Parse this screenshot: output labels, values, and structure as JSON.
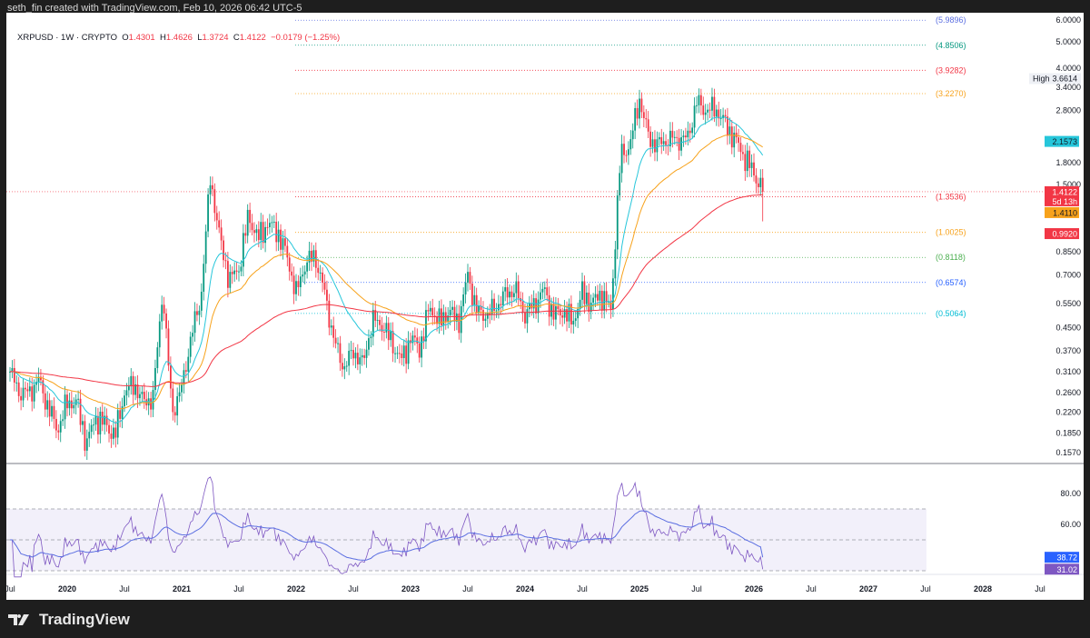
{
  "attribution": "seth_fin created with TradingView.com, Feb 10, 2026 06:42 UTC-5",
  "legend": {
    "symbol": "XRPUSD · 1W · CRYPTO",
    "o_label": "O",
    "o": "1.4301",
    "h_label": "H",
    "h": "1.4626",
    "l_label": "L",
    "l": "1.3724",
    "c_label": "C",
    "c": "1.4122",
    "change": "−0.0179 (−1.25%)"
  },
  "footer": {
    "brand": "TradingView"
  },
  "colors": {
    "up": "#089981",
    "down": "#f23645",
    "ma_fast": "#26c6da",
    "ma_mid": "#f7a21b",
    "ma_slow": "#f23645",
    "rsi": "#5b6ee1"
  },
  "chart_data": [
    {
      "type": "candlestick",
      "title": "XRPUSD 1W",
      "scale": "log",
      "y_ticks": [
        "6.0000",
        "5.0000",
        "4.0000",
        "3.4000",
        "2.8000",
        "1.8000",
        "1.5000",
        "0.8500",
        "0.7000",
        "0.5500",
        "0.4500",
        "0.3700",
        "0.3100",
        "0.2600",
        "0.2200",
        "0.1850",
        "0.1570"
      ],
      "x_ticks": [
        "Jul",
        "2020",
        "Jul",
        "2021",
        "Jul",
        "2022",
        "Jul",
        "2023",
        "Jul",
        "2024",
        "Jul",
        "2025",
        "Jul",
        "2026",
        "Jul",
        "2027",
        "Jul",
        "2028",
        "Jul"
      ],
      "x_start": 2019.5,
      "monthly_closes": [
        0.31,
        0.26,
        0.26,
        0.29,
        0.23,
        0.19,
        0.24,
        0.24,
        0.17,
        0.21,
        0.2,
        0.18,
        0.26,
        0.28,
        0.24,
        0.25,
        0.62,
        0.22,
        0.27,
        0.42,
        0.57,
        1.6,
        0.95,
        0.67,
        0.74,
        1.16,
        0.95,
        1.08,
        1.02,
        0.83,
        0.6,
        0.78,
        0.82,
        0.6,
        0.4,
        0.32,
        0.37,
        0.33,
        0.48,
        0.46,
        0.4,
        0.34,
        0.41,
        0.38,
        0.54,
        0.47,
        0.52,
        0.47,
        0.7,
        0.51,
        0.5,
        0.54,
        0.6,
        0.62,
        0.5,
        0.55,
        0.62,
        0.5,
        0.52,
        0.47,
        0.6,
        0.55,
        0.6,
        0.52,
        1.9,
        2.1,
        3.1,
        2.2,
        2.1,
        2.2,
        2.2,
        2.2,
        3.0,
        2.8,
        2.85,
        2.5,
        2.2,
        1.9,
        1.65,
        1.41
      ],
      "fib_levels": [
        {
          "label": "(5.9896)",
          "value": 5.9896,
          "color": "#5b6ee1"
        },
        {
          "label": "(4.8506)",
          "value": 4.8506,
          "color": "#089981"
        },
        {
          "label": "(3.9282)",
          "value": 3.9282,
          "color": "#f23645"
        },
        {
          "label": "(3.2270)",
          "value": 3.227,
          "color": "#f7a21b"
        },
        {
          "label": "(1.3536)",
          "value": 1.3536,
          "color": "#f23645"
        },
        {
          "label": "(1.0025)",
          "value": 1.0025,
          "color": "#f7a21b"
        },
        {
          "label": "(0.8118)",
          "value": 0.8118,
          "color": "#4caf50"
        },
        {
          "label": "(0.6574)",
          "value": 0.6574,
          "color": "#2962ff"
        },
        {
          "label": "(0.5064)",
          "value": 0.5064,
          "color": "#00bcd4"
        }
      ],
      "price_tags": [
        {
          "label": "2.1573",
          "value": 2.1573,
          "bg": "#26c6da",
          "fg": "#131722"
        },
        {
          "label": "1.4122",
          "sub": "5d 13h",
          "value": 1.4122,
          "bg": "#f23645",
          "fg": "#ffffff"
        },
        {
          "label": "1.4110",
          "value": 1.411,
          "bg": "#f7a21b",
          "fg": "#131722"
        },
        {
          "label": "0.9920",
          "value": 0.992,
          "bg": "#f23645",
          "fg": "#ffffff"
        }
      ],
      "high_marker": {
        "label": "High",
        "value_label": "3.6614",
        "value": 3.6614
      }
    },
    {
      "type": "line",
      "title": "RSI",
      "y_ticks": [
        "80.00",
        "60.00"
      ],
      "band": [
        30,
        70
      ],
      "values_last": [
        {
          "label": "38.72",
          "value": 38.72,
          "bg": "#2962ff"
        },
        {
          "label": "31.02",
          "value": 31.02,
          "bg": "#7e57c2"
        }
      ]
    }
  ]
}
